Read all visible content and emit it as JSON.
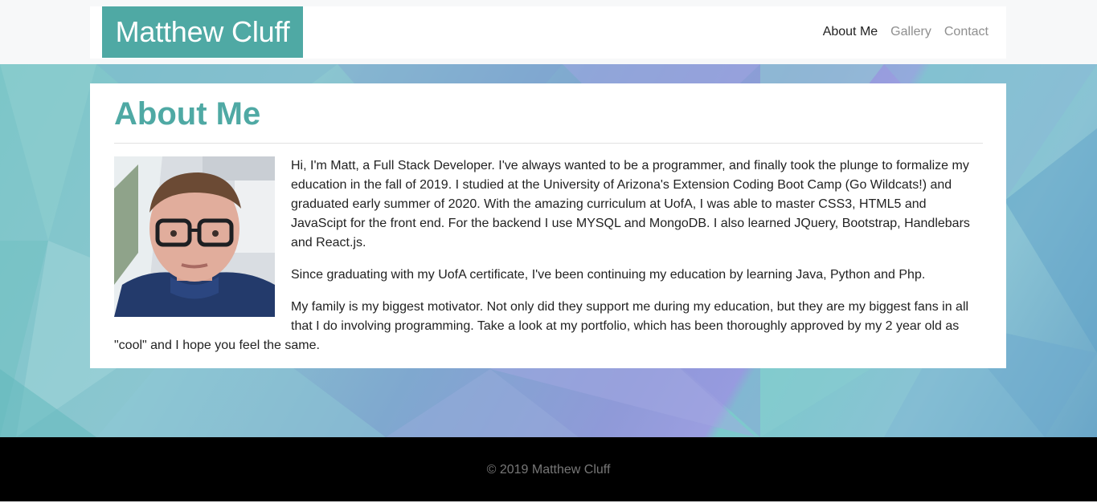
{
  "header": {
    "brand": "Matthew Cluff",
    "nav": [
      {
        "label": "About Me",
        "active": true
      },
      {
        "label": "Gallery",
        "active": false
      },
      {
        "label": "Contact",
        "active": false
      }
    ]
  },
  "main": {
    "title": "About Me",
    "paragraphs": [
      "Hi, I'm Matt, a Full Stack Developer. I've always wanted to be a programmer, and finally took the plunge to formalize my education in the fall of 2019. I studied at the University of Arizona's Extension Coding Boot Camp (Go Wildcats!) and graduated early summer of 2020. With the amazing curriculum at UofA, I was able to master CSS3, HTML5 and JavaScipt for the front end. For the backend I use MYSQL and MongoDB. I also learned JQuery, Bootstrap, Handlebars and React.js.",
      "Since graduating with my UofA certificate, I've been continuing my education by learning Java, Python and Php.",
      "My family is my biggest motivator. Not only did they support me during my education, but they are my biggest fans in all that I do involving programming. Take a look at my portfolio, which has been thoroughly approved by my 2 year old as \"cool\" and I hope you feel the same."
    ]
  },
  "footer": {
    "copyright": "© 2019 Matthew Cluff"
  },
  "colors": {
    "brand": "#4fa9a4",
    "footer_bg": "#000000"
  }
}
